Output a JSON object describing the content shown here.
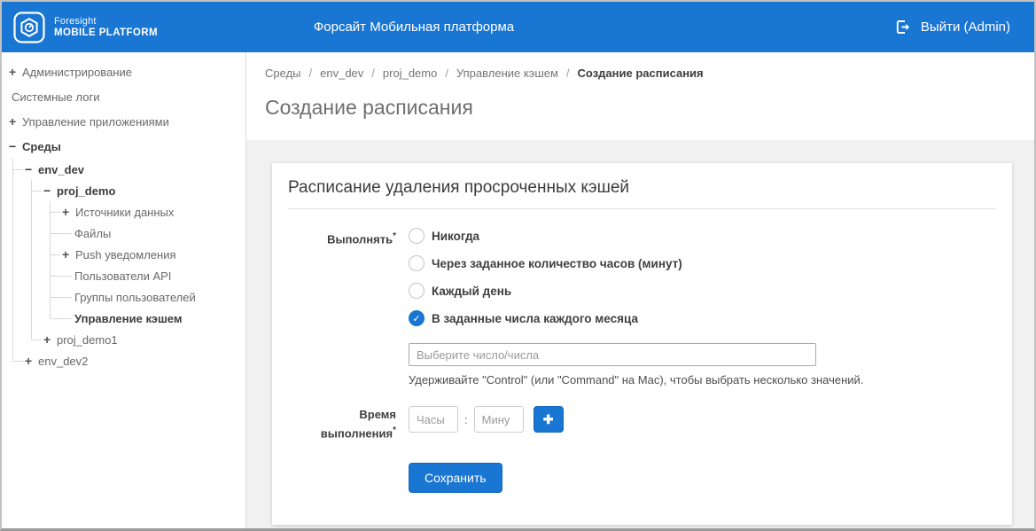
{
  "header": {
    "logo_line1": "Foresight",
    "logo_line2": "MOBILE PLATFORM",
    "title": "Форсайт Мобильная платформа",
    "logout_label": "Выйти (Admin)"
  },
  "sidebar": {
    "items": [
      {
        "icon": "+",
        "label": "Администрирование"
      },
      {
        "icon": "",
        "label": "Системные логи"
      },
      {
        "icon": "+",
        "label": "Управление приложениями"
      },
      {
        "icon": "−",
        "label": "Среды"
      },
      {
        "icon": "−",
        "label": "env_dev"
      },
      {
        "icon": "−",
        "label": "proj_demo"
      },
      {
        "icon": "+",
        "label": "Источники данных"
      },
      {
        "icon": "",
        "label": "Файлы"
      },
      {
        "icon": "+",
        "label": "Push уведомления"
      },
      {
        "icon": "",
        "label": "Пользователи API"
      },
      {
        "icon": "",
        "label": "Группы пользователей"
      },
      {
        "icon": "",
        "label": "Управление кэшем"
      },
      {
        "icon": "+",
        "label": "proj_demo1"
      },
      {
        "icon": "+",
        "label": "env_dev2"
      }
    ]
  },
  "breadcrumb": {
    "separator": "/",
    "items": [
      "Среды",
      "env_dev",
      "proj_demo",
      "Управление кэшем",
      "Создание расписания"
    ]
  },
  "page": {
    "title": "Создание расписания"
  },
  "card": {
    "title": "Расписание удаления просроченных кэшей",
    "execute_label": "Выполнять",
    "required_mark": "*",
    "radios": [
      {
        "label": "Никогда",
        "checked": false
      },
      {
        "label": "Через заданное количество часов (минут)",
        "checked": false
      },
      {
        "label": "Каждый день",
        "checked": false
      },
      {
        "label": "В заданные числа каждого месяца",
        "checked": true
      }
    ],
    "check_icon": "✓",
    "select_placeholder": "Выберите число/числа",
    "help_text": "Удерживайте \"Control\" (или \"Command\" на Mac), чтобы выбрать несколько значений.",
    "time_label_line1": "Время",
    "time_label_line2": "выполнения",
    "hours_placeholder": "Часы",
    "minutes_placeholder": "Мину",
    "add_button_icon": "✚",
    "save_button": "Сохранить"
  },
  "colors": {
    "header_blue": "#1976d2",
    "accent_blue": "#1976d2",
    "content_gray": "#f1f1f2"
  }
}
